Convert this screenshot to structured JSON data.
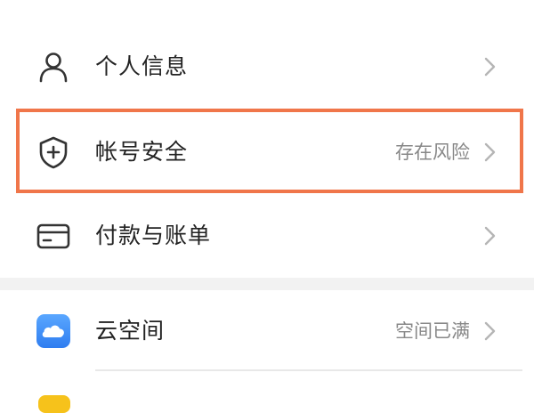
{
  "settings": {
    "group1": [
      {
        "label": "个人信息",
        "value": "",
        "icon": "person-icon"
      },
      {
        "label": "帐号安全",
        "value": "存在风险",
        "icon": "shield-plus-icon"
      },
      {
        "label": "付款与账单",
        "value": "",
        "icon": "card-icon"
      }
    ],
    "group2": [
      {
        "label": "云空间",
        "value": "空间已满",
        "icon": "cloud-icon"
      }
    ]
  },
  "colors": {
    "highlight": "#f0764a",
    "text_primary": "#222222",
    "text_secondary": "#888888",
    "section_gap": "#f2f2f2",
    "cloud_gradient_top": "#5aa7ff",
    "cloud_gradient_bottom": "#2f7df0"
  }
}
